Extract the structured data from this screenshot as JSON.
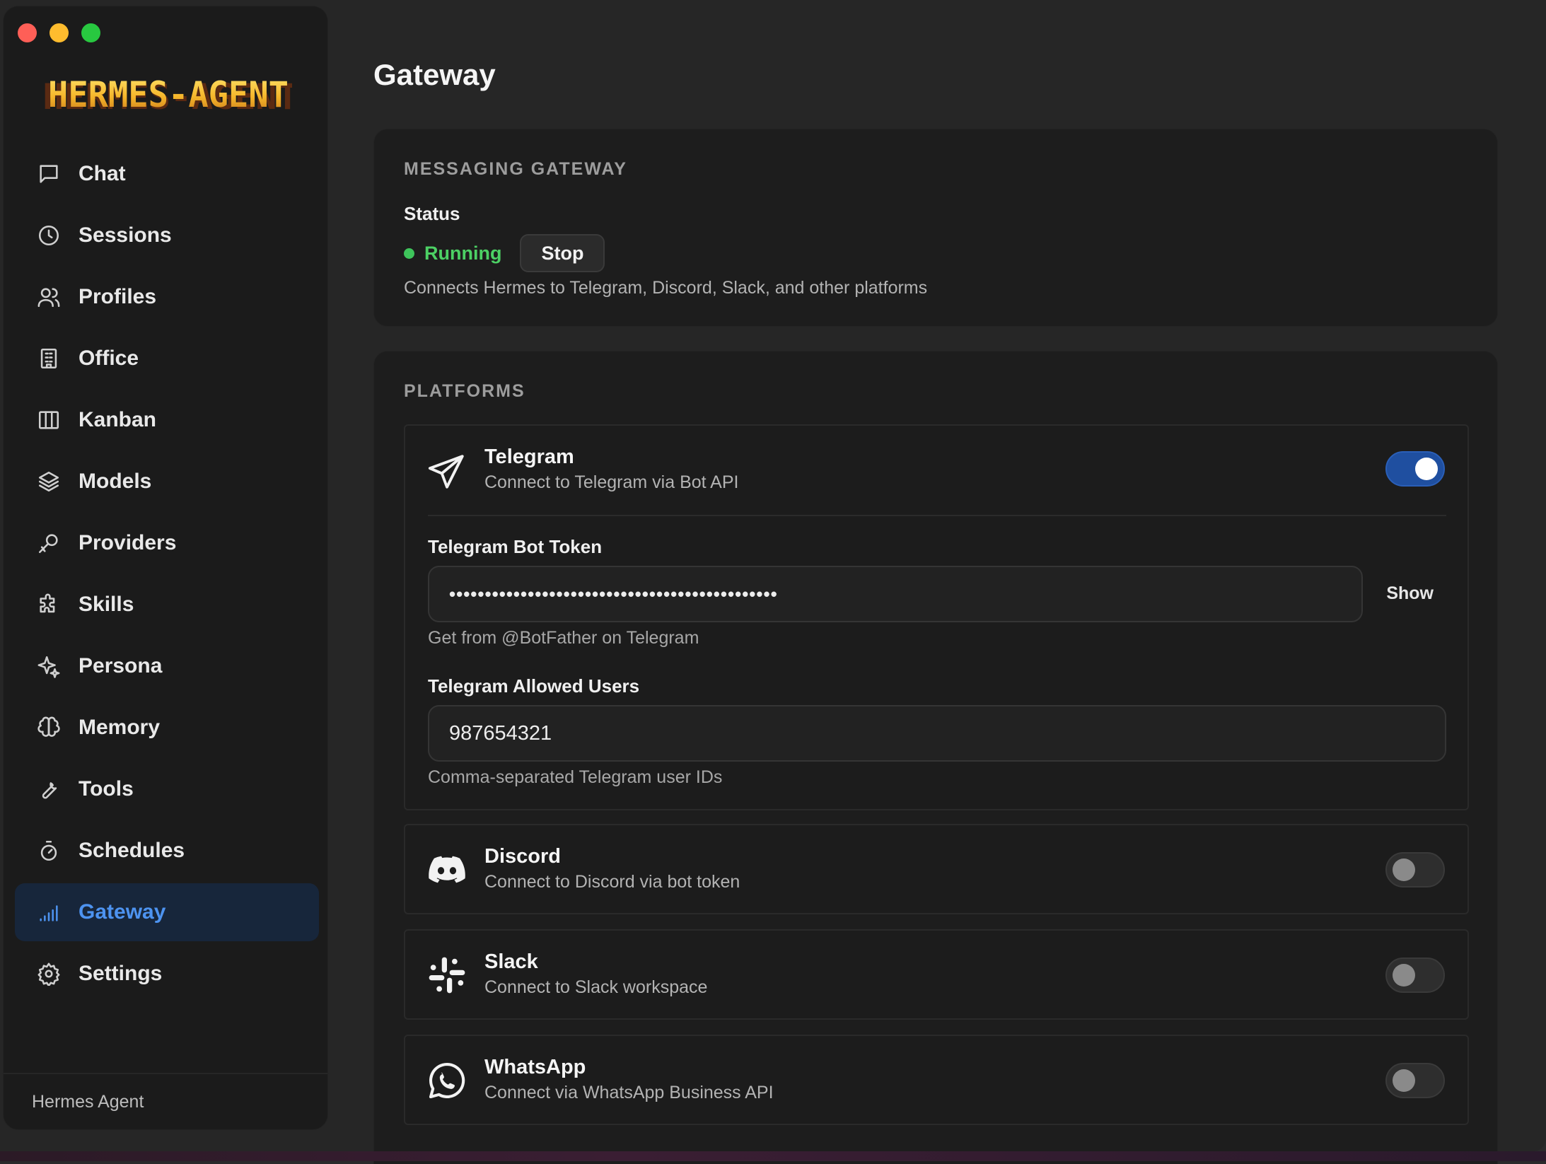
{
  "app": {
    "logo_text": "HERMES-AGENT",
    "footer_label": "Hermes Agent"
  },
  "sidebar": {
    "items": [
      {
        "label": "Chat",
        "icon": "chat-icon",
        "active": false
      },
      {
        "label": "Sessions",
        "icon": "clock-icon",
        "active": false
      },
      {
        "label": "Profiles",
        "icon": "users-icon",
        "active": false
      },
      {
        "label": "Office",
        "icon": "building-icon",
        "active": false
      },
      {
        "label": "Kanban",
        "icon": "kanban-icon",
        "active": false
      },
      {
        "label": "Models",
        "icon": "layers-icon",
        "active": false
      },
      {
        "label": "Providers",
        "icon": "key-icon",
        "active": false
      },
      {
        "label": "Skills",
        "icon": "puzzle-icon",
        "active": false
      },
      {
        "label": "Persona",
        "icon": "sparkles-icon",
        "active": false
      },
      {
        "label": "Memory",
        "icon": "brain-icon",
        "active": false
      },
      {
        "label": "Tools",
        "icon": "wrench-icon",
        "active": false
      },
      {
        "label": "Schedules",
        "icon": "timer-icon",
        "active": false
      },
      {
        "label": "Gateway",
        "icon": "signal-icon",
        "active": true
      },
      {
        "label": "Settings",
        "icon": "gear-icon",
        "active": false
      }
    ]
  },
  "page": {
    "title": "Gateway"
  },
  "gateway": {
    "section_label": "MESSAGING GATEWAY",
    "status_label": "Status",
    "status_value": "Running",
    "stop_label": "Stop",
    "description": "Connects Hermes to Telegram, Discord, Slack, and other platforms"
  },
  "platforms": {
    "section_label": "PLATFORMS",
    "telegram": {
      "name": "Telegram",
      "description": "Connect to Telegram via Bot API",
      "enabled": true,
      "token_label": "Telegram Bot Token",
      "token_value": "••••••••••••••••••••••••••••••••••••••••••••••",
      "show_label": "Show",
      "token_hint": "Get from @BotFather on Telegram",
      "users_label": "Telegram Allowed Users",
      "users_value": "987654321",
      "users_hint": "Comma-separated Telegram user IDs"
    },
    "discord": {
      "name": "Discord",
      "description": "Connect to Discord via bot token",
      "enabled": false
    },
    "slack": {
      "name": "Slack",
      "description": "Connect to Slack workspace",
      "enabled": false
    },
    "whatsapp": {
      "name": "WhatsApp",
      "description": "Connect via WhatsApp Business API",
      "enabled": false
    }
  },
  "colors": {
    "accent": "#4d93f0",
    "status_green": "#4cd064",
    "toggle_on": "#1f4fa0"
  }
}
